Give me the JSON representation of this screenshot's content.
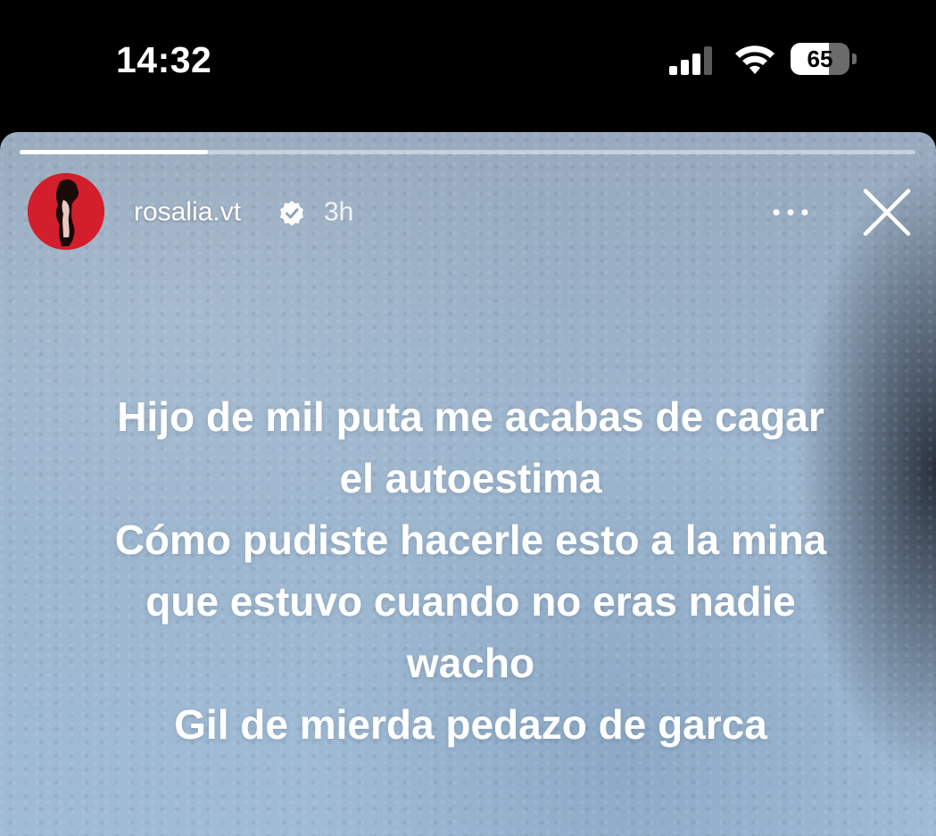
{
  "status_bar": {
    "time": "14:32",
    "battery_level": "65",
    "battery_percent": 65,
    "icons": [
      "signal-icon",
      "wifi-icon",
      "battery-icon"
    ]
  },
  "story": {
    "progress_fraction": 0.21,
    "username": "rosalia.vt",
    "time_ago": "3h",
    "accent_color": "#d21f2b",
    "icons": [
      "verified-icon",
      "more-icon",
      "close-icon"
    ],
    "text_lines": [
      "Hijo de mil puta me acabas de cagar",
      "el autoestima",
      "Cómo pudiste hacerle esto a la mina",
      "que estuvo cuando no eras nadie",
      "wacho",
      "Gil de mierda pedazo de garca"
    ]
  }
}
